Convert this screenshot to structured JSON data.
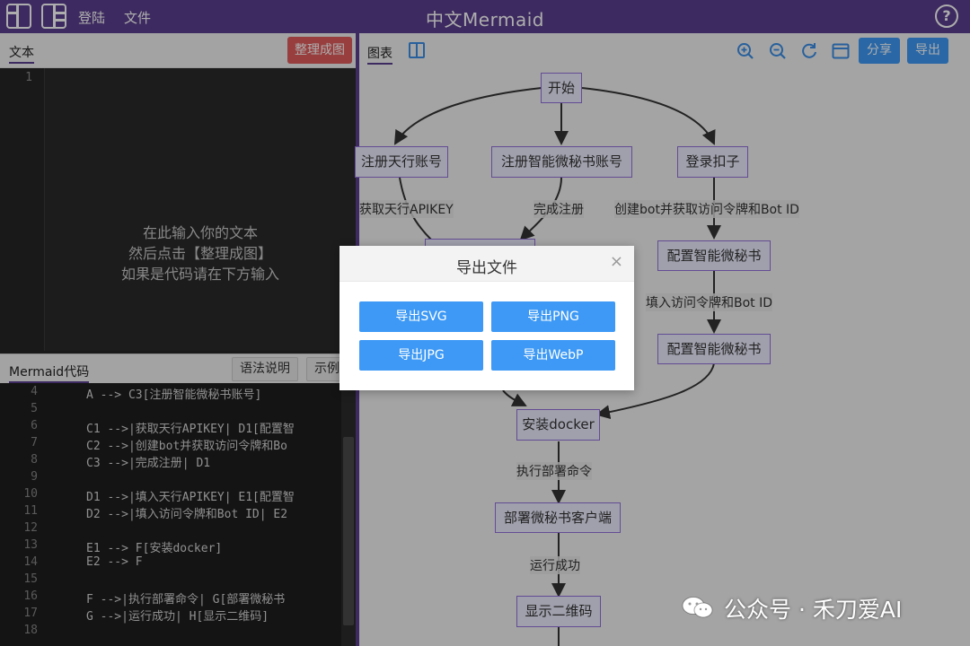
{
  "topbar": {
    "login": "登陆",
    "file": "文件",
    "title": "中文Mermaid",
    "help": "?"
  },
  "text_panel": {
    "tab": "文本",
    "organize": "整理成图",
    "line_number": "1",
    "placeholder": [
      "在此输入你的文本",
      "然后点击【整理成图】",
      "如果是代码请在下方输入"
    ]
  },
  "code_panel": {
    "tab": "Mermaid代码",
    "syntax": "语法说明",
    "examples": "示例",
    "lines": [
      {
        "n": "4",
        "t": "A --> C3[注册智能微秘书账号]"
      },
      {
        "n": "5",
        "t": ""
      },
      {
        "n": "6",
        "t": "C1 -->|获取天行APIKEY| D1[配置智"
      },
      {
        "n": "7",
        "t": "C2 -->|创建bot并获取访问令牌和Bo"
      },
      {
        "n": "8",
        "t": "C3 -->|完成注册| D1"
      },
      {
        "n": "9",
        "t": ""
      },
      {
        "n": "10",
        "t": "D1 -->|填入天行APIKEY| E1[配置智"
      },
      {
        "n": "11",
        "t": "D2 -->|填入访问令牌和Bot ID| E2"
      },
      {
        "n": "12",
        "t": ""
      },
      {
        "n": "13",
        "t": "E1 --> F[安装docker]"
      },
      {
        "n": "14",
        "t": "E2 --> F"
      },
      {
        "n": "15",
        "t": ""
      },
      {
        "n": "16",
        "t": "F -->|执行部署命令| G[部署微秘书"
      },
      {
        "n": "17",
        "t": "G -->|运行成功| H[显示二维码]"
      },
      {
        "n": "18",
        "t": ""
      }
    ]
  },
  "chart_panel": {
    "tab": "图表",
    "share": "分享",
    "export": "导出"
  },
  "diagram": {
    "nodes": {
      "start": "开始",
      "c1": "注册天行账号",
      "c3": "注册智能微秘书账号",
      "c2": "登录扣子",
      "d2": "配置智能微秘书",
      "e2": "配置智能微秘书",
      "f": "安装docker",
      "g": "部署微秘书客户端",
      "h": "显示二维码"
    },
    "edges": {
      "l1": "获取天行APIKEY",
      "l2": "完成注册",
      "l3": "创建bot并获取访问令牌和Bot ID",
      "l4": "填入访问令牌和Bot ID",
      "l5": "执行部署命令",
      "l6": "运行成功"
    }
  },
  "modal": {
    "title": "导出文件",
    "close": "×",
    "buttons": [
      "导出SVG",
      "导出PNG",
      "导出JPG",
      "导出WebP"
    ]
  },
  "watermark": {
    "text": "公众号 · 禾刀爱AI"
  },
  "icons": [
    "layout-left-icon",
    "layout-right-icon",
    "help-icon",
    "split-view-icon",
    "zoom-in-icon",
    "zoom-out-icon",
    "refresh-icon",
    "window-icon",
    "close-icon",
    "wechat-icon"
  ],
  "colors": {
    "topbar": "#5a3e8e",
    "accent_blue": "#3d99f5",
    "organize_red": "#e05c5c",
    "node_fill": "#ececff",
    "node_border": "#9370db"
  }
}
